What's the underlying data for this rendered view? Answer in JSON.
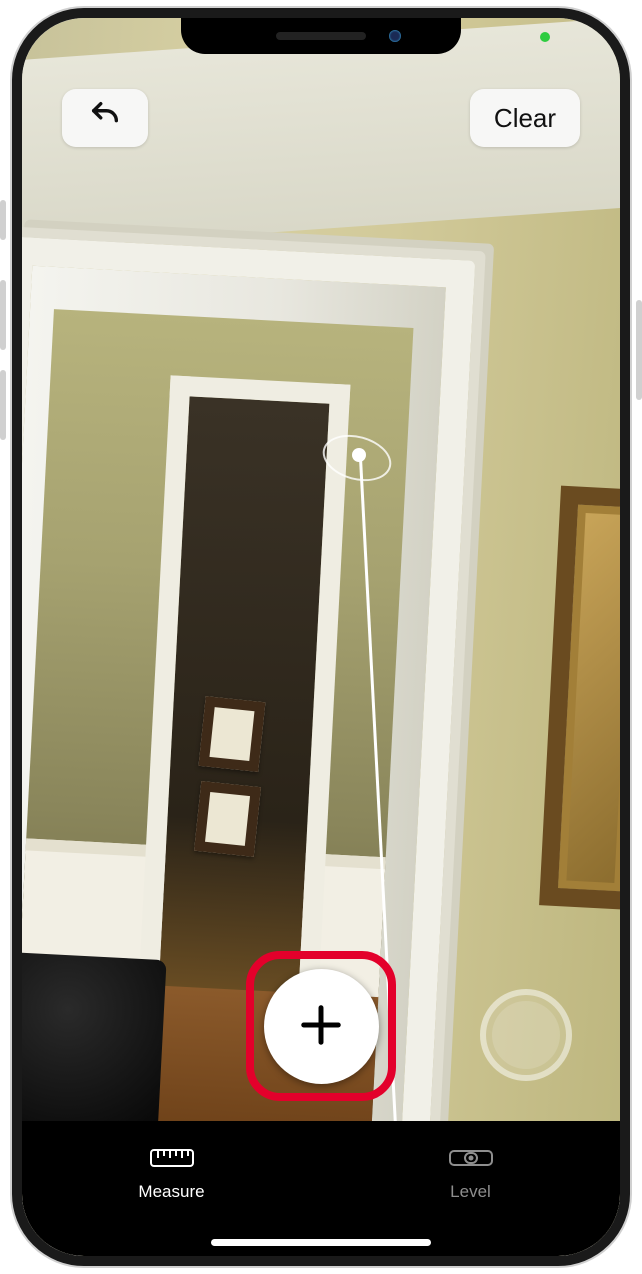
{
  "top": {
    "undo_label": "Undo",
    "clear_label": "Clear"
  },
  "controls": {
    "add_point_label": "Add point",
    "shutter_label": "Capture"
  },
  "tabs": {
    "measure": "Measure",
    "level": "Level",
    "active": "measure"
  },
  "annotation": {
    "highlight_target": "add-point-button",
    "highlight_color": "#e3002b"
  }
}
